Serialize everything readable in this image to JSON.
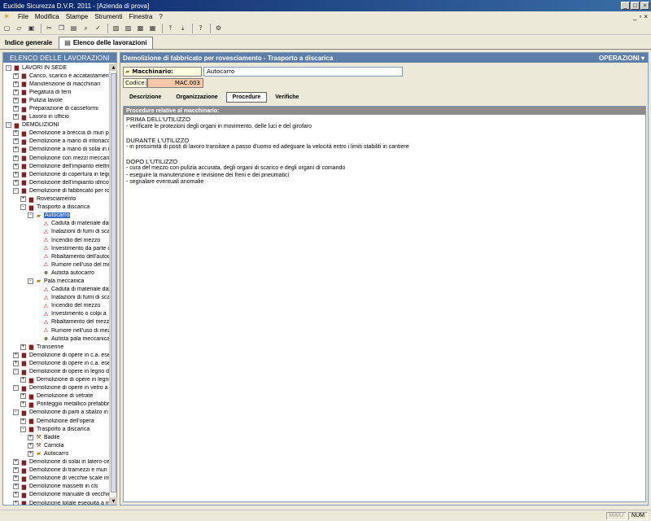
{
  "window": {
    "title": "Euclide Sicurezza D.V.R. 2011 - [Azienda di prova]"
  },
  "menu": {
    "items": [
      "File",
      "Modifica",
      "Stampe",
      "Strumenti",
      "Finestra",
      "?"
    ]
  },
  "viewtabs": {
    "indice": "Indice generale",
    "elenco": "Elenco delle lavorazioni"
  },
  "left": {
    "header": "ELENCO DELLE LAVORAZIONI",
    "tree": [
      {
        "level": 0,
        "exp": "-",
        "icon": "book",
        "label": "LAVORI IN SEDE"
      },
      {
        "level": 1,
        "exp": "+",
        "icon": "book",
        "label": "Carico, scarico e accatastamento"
      },
      {
        "level": 1,
        "exp": "+",
        "icon": "book",
        "label": "Manutenzione di macchinari"
      },
      {
        "level": 1,
        "exp": "+",
        "icon": "book",
        "label": "Piegatura di ferri"
      },
      {
        "level": 1,
        "exp": "+",
        "icon": "book",
        "label": "Pulizia lavole"
      },
      {
        "level": 1,
        "exp": "+",
        "icon": "book",
        "label": "Preparazione di casseformi"
      },
      {
        "level": 1,
        "exp": "+",
        "icon": "book",
        "label": "Lavoro in ufficio"
      },
      {
        "level": 0,
        "exp": "-",
        "icon": "book",
        "label": "DEMOLIZIONI"
      },
      {
        "level": 1,
        "exp": "+",
        "icon": "book",
        "label": "Demolizione a breccia di muri por"
      },
      {
        "level": 1,
        "exp": "+",
        "icon": "book",
        "label": "Demolizione a mano di intonaco i"
      },
      {
        "level": 1,
        "exp": "+",
        "icon": "book",
        "label": "Demolizione a mano di solai in m"
      },
      {
        "level": 1,
        "exp": "+",
        "icon": "book",
        "label": "Demolizione con mezzi meccanic"
      },
      {
        "level": 1,
        "exp": "+",
        "icon": "book",
        "label": "Demolizione dell'impianto elettric"
      },
      {
        "level": 1,
        "exp": "+",
        "icon": "book",
        "label": "Demolizione di copertura in tegol"
      },
      {
        "level": 1,
        "exp": "+",
        "icon": "book",
        "label": "Demolizione dell'impianto idrico-s"
      },
      {
        "level": 1,
        "exp": "-",
        "icon": "book",
        "label": "Demolizione di fabbricato per rov"
      },
      {
        "level": 2,
        "exp": "+",
        "icon": "book",
        "label": "Rovesciamento"
      },
      {
        "level": 2,
        "exp": "-",
        "icon": "book",
        "label": "Trasporto a discarica"
      },
      {
        "level": 3,
        "exp": "-",
        "icon": "folder",
        "label": "Autocarro",
        "selected": true
      },
      {
        "level": 4,
        "exp": "",
        "icon": "warn",
        "label": "Caduta di materiale dal"
      },
      {
        "level": 4,
        "exp": "",
        "icon": "warn",
        "label": "Inalazioni di fumi di sca"
      },
      {
        "level": 4,
        "exp": "",
        "icon": "warn",
        "label": "Incendio del mezzo"
      },
      {
        "level": 4,
        "exp": "",
        "icon": "warn",
        "label": "Investimento da parte c"
      },
      {
        "level": 4,
        "exp": "",
        "icon": "warn",
        "label": "Ribaltamento dell'autoc"
      },
      {
        "level": 4,
        "exp": "",
        "icon": "warn",
        "label": "Rumore nell'uso del me"
      },
      {
        "level": 4,
        "exp": "",
        "icon": "person",
        "label": "Autista autocarro"
      },
      {
        "level": 3,
        "exp": "-",
        "icon": "folder",
        "label": "Pala meccanica"
      },
      {
        "level": 4,
        "exp": "",
        "icon": "warn",
        "label": "Caduta di materiale dal"
      },
      {
        "level": 4,
        "exp": "",
        "icon": "warn",
        "label": "Inalazioni di fumi di sca"
      },
      {
        "level": 4,
        "exp": "",
        "icon": "warn",
        "label": "Incendio del mezzo"
      },
      {
        "level": 4,
        "exp": "",
        "icon": "warn",
        "label": "Investimento o colpi a"
      },
      {
        "level": 4,
        "exp": "",
        "icon": "warn",
        "label": "Ribaltamento del mezz"
      },
      {
        "level": 4,
        "exp": "",
        "icon": "warn",
        "label": "Rumore nell'uso di mez"
      },
      {
        "level": 4,
        "exp": "",
        "icon": "person",
        "label": "Autista pala meccanica"
      },
      {
        "level": 2,
        "exp": "+",
        "icon": "book",
        "label": "Transenne"
      },
      {
        "level": 1,
        "exp": "+",
        "icon": "book",
        "label": "Demolizione di opere in c.a. esec"
      },
      {
        "level": 1,
        "exp": "+",
        "icon": "book",
        "label": "Demolizione di opere in c.a. esec"
      },
      {
        "level": 1,
        "exp": "-",
        "icon": "book",
        "label": "Demolizione di opere in legno di r"
      },
      {
        "level": 2,
        "exp": "+",
        "icon": "book",
        "label": "Demolizione di opere in legno"
      },
      {
        "level": 1,
        "exp": "-",
        "icon": "book",
        "label": "Demolizione di opere in vetro a p"
      },
      {
        "level": 2,
        "exp": "+",
        "icon": "book",
        "label": "Demolizione di vetrate"
      },
      {
        "level": 2,
        "exp": "+",
        "icon": "book",
        "label": "Ponteggio metallico prefabbric"
      },
      {
        "level": 1,
        "exp": "-",
        "icon": "book",
        "label": "Demolizione di parti a sbalzo in c."
      },
      {
        "level": 2,
        "exp": "+",
        "icon": "book",
        "label": "Demolizione dell'opera"
      },
      {
        "level": 2,
        "exp": "-",
        "icon": "book",
        "label": "Trasporto a discarica"
      },
      {
        "level": 3,
        "exp": "+",
        "icon": "tool",
        "label": "Badile"
      },
      {
        "level": 3,
        "exp": "+",
        "icon": "tool",
        "label": "Carriola"
      },
      {
        "level": 3,
        "exp": "+",
        "icon": "folder",
        "label": "Autocarro"
      },
      {
        "level": 1,
        "exp": "+",
        "icon": "book",
        "label": "Demolizione di solai in latero-cem"
      },
      {
        "level": 1,
        "exp": "+",
        "icon": "book",
        "label": "Demolizione di tramezzi e muri div"
      },
      {
        "level": 1,
        "exp": "+",
        "icon": "book",
        "label": "Demolizione di vecchie scale inte"
      },
      {
        "level": 1,
        "exp": "+",
        "icon": "book",
        "label": "Demolizione massetti in cls"
      },
      {
        "level": 1,
        "exp": "+",
        "icon": "book",
        "label": "Demolizione manuale di vecchie"
      },
      {
        "level": 1,
        "exp": "+",
        "icon": "book",
        "label": "Demolizione totale eseguita a mar"
      }
    ]
  },
  "right": {
    "header": "Demolizione di fabbricato per rovesciamento - Trasporto a discarica",
    "operations": "OPERAZIONI ▾",
    "macchinario_label": "Macchinario:",
    "macchinario_value": "Autocarro",
    "codice_label": "Codice:",
    "codice_value": "MAC.003",
    "tabs": [
      "Descrizione",
      "Organizzazione",
      "Procedure",
      "Verifiche"
    ],
    "active_tab": "Procedure",
    "procedures_header": "Procedure relative al macchinario:",
    "procedures": [
      {
        "text": "PRIMA DELL'UTILIZZO",
        "head": true
      },
      {
        "text": "- verificare le protezioni degli organi in movimento, delle luci e del girofaro",
        "head": false
      },
      {
        "text": "",
        "head": false
      },
      {
        "text": "DURANTE L'UTILIZZO",
        "head": true
      },
      {
        "text": "- in prossimità di posti di lavoro transitare a passo d'uomo ed adeguare la velocità entro i limiti stabiliti in cantiere",
        "head": false
      },
      {
        "text": "",
        "head": false
      },
      {
        "text": "DOPO L'UTILIZZO",
        "head": true
      },
      {
        "text": "- cura del mezzo con pulizia accurata, degli organi di scarico e degli organi di comando",
        "head": false
      },
      {
        "text": "- eseguire la manutenzione e revisione dei freni e dei pneumatici",
        "head": false
      },
      {
        "text": "- segnalare eventuali anomalie",
        "head": false
      }
    ]
  },
  "status": {
    "maiu": "MAIU",
    "num": "NUM"
  },
  "colors": {
    "panel_header": "#5d7ea8",
    "selection": "#316ac5",
    "codice_bg": "#f4c8a8"
  }
}
